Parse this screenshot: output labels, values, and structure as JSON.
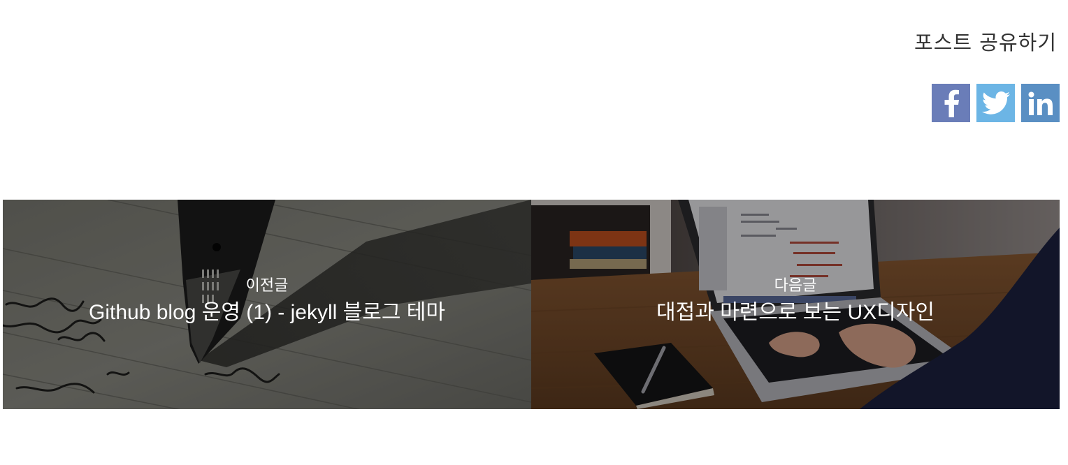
{
  "share": {
    "title": "포스트 공유하기",
    "buttons": [
      {
        "name": "facebook",
        "icon": "facebook-icon",
        "color": "#6a7db8"
      },
      {
        "name": "twitter",
        "icon": "twitter-icon",
        "color": "#6cb5e5"
      },
      {
        "name": "linkedin",
        "icon": "linkedin-icon",
        "color": "#5a8fc3"
      }
    ]
  },
  "post_nav": {
    "previous": {
      "label": "이전글",
      "title": "Github blog 운영 (1) - jekyll 블로그 테마",
      "image": "fountain-pen-writing-photo"
    },
    "next": {
      "label": "다음글",
      "title": "대접과 마련으로 보는 UX디자인",
      "image": "laptop-on-desk-photo"
    }
  }
}
